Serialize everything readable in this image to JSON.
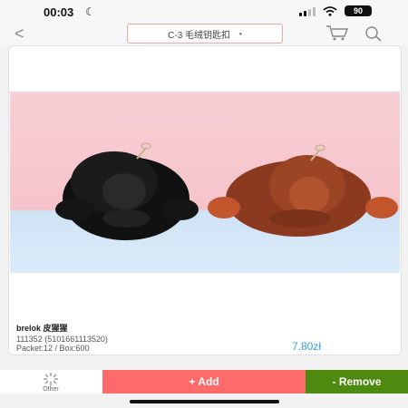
{
  "status": {
    "time": "00:03",
    "battery": "90"
  },
  "header": {
    "back_icon": "chevron-left-icon",
    "category_select": "C-3 毛绒钥匙扣",
    "cart_icon": "cart-icon",
    "search_icon": "search-icon"
  },
  "product": {
    "name": "brelok 皮猩猩",
    "code": "111352 (5101661113520)",
    "packet": "Packet:12 / Box:600",
    "price": "7.80zł",
    "image": "product-photo-gorilla-keychains"
  },
  "bottom": {
    "other_label": "Other",
    "add_label": "+ Add",
    "remove_label": "- Remove"
  },
  "colors": {
    "add": "#ff6b6b",
    "remove": "#4f8a10",
    "price": "#2f9fe0",
    "select_border": "#f0a7a2"
  }
}
